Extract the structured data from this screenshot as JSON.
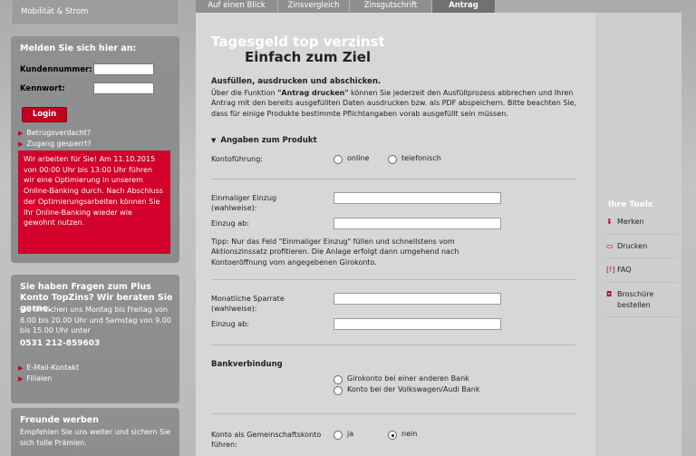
{
  "sidebar": {
    "top_tab": "Mobilität & Strom",
    "login": {
      "title": "Melden Sie sich hier an:",
      "username_label": "Kundennummer:",
      "password_label": "Kennwort:",
      "username_value": "",
      "password_value": "",
      "login_button": "Login",
      "fraud_link": "Betrugsverdacht?",
      "locked_link": "Zugang gesperrt?",
      "alert_text": "Wir arbeiten für Sie! Am 11.10.2015 von 00:00 Uhr bis 13:00 Uhr führen wir eine Optimierung in unserem Online-Banking durch. Nach Abschluss der Optimierungsarbeiten können Sie Ihr Online-Banking wieder wie gewohnt nutzen."
    },
    "contact": {
      "title": "Sie haben Fragen zum Plus Konto TopZins? Wir beraten Sie gerne.",
      "text": "Sie erreichen uns Montag bis Freitag von 8.00 bis 20.00 Uhr und Samstag von 9.00 bis 15.00 Uhr unter",
      "phone": "0531 212-859603",
      "email_link": "E-Mail-Kontakt",
      "branches_link": "Filialen"
    },
    "friends": {
      "title": "Freunde werben",
      "text": "Empfehlen Sie uns weiter und sichern Sie sich tolle Prämien."
    }
  },
  "tabs": [
    {
      "label": "Auf einen Blick"
    },
    {
      "label": "Zinsvergleich"
    },
    {
      "label": "Zinsgutschrift"
    },
    {
      "label": "Antrag"
    }
  ],
  "main": {
    "title_line1": "Tagesgeld top verzinst",
    "title_line2": "Einfach zum Ziel",
    "intro_heading": "Ausfüllen, ausdrucken und abschicken.",
    "intro_text_before": "Über die Funktion ",
    "intro_text_bold": "\"Antrag drucken\"",
    "intro_text_after": " können Sie jederzeit den Ausfüllprozess abbrechen und Ihren Antrag mit den bereits ausgefüllten Daten ausdrucken bzw. als PDF abspeichern. Bitte beachten Sie, dass für einige Produkte bestimmte Pflichtangaben vorab ausgefüllt sein müssen.",
    "section_title": "Angaben zum Produkt",
    "account_mode_label": "Kontoführung:",
    "account_mode_options": [
      "online",
      "telefonisch"
    ],
    "single_deposit_label": "Einmaliger Einzug (wahlweise):",
    "single_deposit_from_label": "Einzug ab:",
    "tip": "Tipp: Nur das Feld \"Einmaliger Einzug\" füllen und schnellstens vom Aktionszinssatz profitieren. Die Anlage erfolgt dann umgehend nach Kontoeröffnung vom angegebenen Girokonto.",
    "monthly_rate_label": "Monatliche Sparrate (wahlweise):",
    "monthly_from_label": "Einzug ab:",
    "bank_heading": "Bankverbindung",
    "bank_options": [
      "Girokonto bei einer anderen Bank",
      "Konto bei der Volkswagen/Audi Bank"
    ],
    "joint_label": "Konto als Gemeinschaftskonto führen:",
    "joint_options": [
      "ja",
      "nein"
    ]
  },
  "tools": {
    "title": "Ihre Tools",
    "items": [
      {
        "label": "Merken",
        "icon": "bookmark-icon"
      },
      {
        "label": "Drucken",
        "icon": "printer-icon"
      },
      {
        "label": "FAQ",
        "icon": "faq-icon"
      },
      {
        "label": "Broschüre bestellen",
        "icon": "brochure-icon"
      }
    ]
  },
  "colors": {
    "accent": "#c4001f",
    "alert_bg": "#d2002a",
    "active_tab": "#6f7173"
  }
}
